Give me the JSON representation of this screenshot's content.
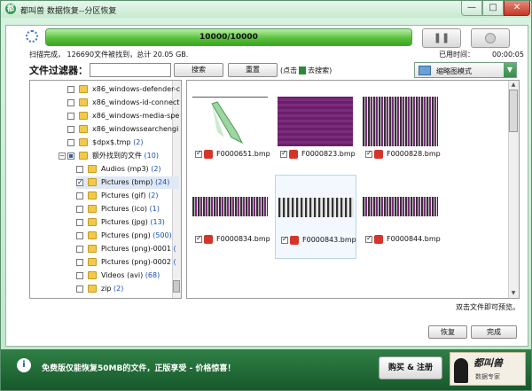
{
  "titlebar": {
    "title": "都叫兽 数据恢复--分区恢复",
    "min": "—",
    "max": "□",
    "close": "✕"
  },
  "progress": {
    "label": "10000/10000",
    "fraction": 1.0
  },
  "controls": {
    "pause": "❚❚"
  },
  "status": {
    "text": "扫描完成， 126690文件被找到，总计 20.05 GB.",
    "elapsed_label": "已用时间：",
    "elapsed_value": "00:00:05"
  },
  "filter": {
    "label": "文件过滤器：",
    "placeholder": "",
    "search": "搜索",
    "reset": "重置",
    "hint_pre": "(点击",
    "hint_post": "去搜索)"
  },
  "view": {
    "label": "缩略图模式",
    "arrow": "▼"
  },
  "tree": [
    {
      "label": "x86_windows-defender-c",
      "count": "",
      "check": "none"
    },
    {
      "label": "x86_windows-id-connect",
      "count": "",
      "check": "none"
    },
    {
      "label": "x86_windows-media-spe",
      "count": "",
      "check": "none"
    },
    {
      "label": "x86_windowssearchengi",
      "count": "",
      "check": "none"
    },
    {
      "label": "$dpx$.tmp",
      "count": "(2)",
      "check": "none"
    },
    {
      "label": "额外找到的文件",
      "count": "(10)",
      "check": "partial",
      "toggle": "−"
    },
    {
      "label": "Audios (mp3)",
      "count": "(2)",
      "check": "none"
    },
    {
      "label": "Pictures (bmp)",
      "count": "(24)",
      "check": "checked",
      "selected": true
    },
    {
      "label": "Pictures (gif)",
      "count": "(2)",
      "check": "none"
    },
    {
      "label": "Pictures (ico)",
      "count": "(1)",
      "check": "none"
    },
    {
      "label": "Pictures (jpg)",
      "count": "(13)",
      "check": "none"
    },
    {
      "label": "Pictures (png)",
      "count": "(500)",
      "check": "none"
    },
    {
      "label": "Pictures (png)-0001",
      "count": "(",
      "check": "none"
    },
    {
      "label": "Pictures (png)-0002",
      "count": "(",
      "check": "none"
    },
    {
      "label": "Videos (avi)",
      "count": "(68)",
      "check": "none"
    },
    {
      "label": "zip",
      "count": "(2)",
      "check": "none"
    }
  ],
  "thumbnails": [
    {
      "name": "F0000651.bmp"
    },
    {
      "name": "F0000823.bmp"
    },
    {
      "name": "F0000828.bmp"
    },
    {
      "name": "F0000834.bmp"
    },
    {
      "name": "F0000843.bmp",
      "selected": true
    },
    {
      "name": "F0000844.bmp"
    }
  ],
  "preview_hint": "双击文件即可预览。",
  "actions": {
    "recover": "恢复",
    "finish": "完成"
  },
  "footer": {
    "info": "i",
    "text": "免费版仅能恢复50MB的文件，正版享受 - 价格惊喜！",
    "buy": "购买 & 注册",
    "logo_title": "都叫兽",
    "logo_sub": "数据专家"
  }
}
